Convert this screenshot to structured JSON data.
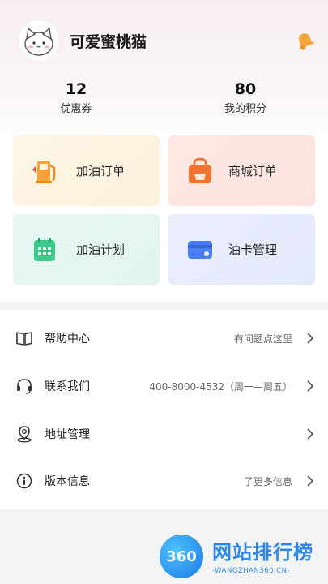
{
  "profile": {
    "username": "可爱蜜桃猫"
  },
  "stats": [
    {
      "value": "12",
      "label": "优惠券"
    },
    {
      "value": "80",
      "label": "我的积分"
    }
  ],
  "cards": [
    {
      "label": "加油订单",
      "icon": "fuel-pump-icon"
    },
    {
      "label": "商城订单",
      "icon": "shopping-bag-icon"
    },
    {
      "label": "加油计划",
      "icon": "calendar-icon"
    },
    {
      "label": "油卡管理",
      "icon": "card-icon"
    }
  ],
  "menu": [
    {
      "label": "帮助中心",
      "value": "有问题点这里",
      "icon": "book-icon"
    },
    {
      "label": "联系我们",
      "value": "400-8000-4532（周一—周五）",
      "icon": "headset-icon"
    },
    {
      "label": "地址管理",
      "value": "",
      "icon": "location-icon"
    },
    {
      "label": "版本信息",
      "value": "了更多信息",
      "icon": "info-icon"
    }
  ],
  "watermark": {
    "logo": "360",
    "title": "网站排行榜",
    "subtitle": "-WANGZHAN360.CN-"
  },
  "colors": {
    "accent_blue": "#2b87e8",
    "fuel_orange": "#f5a43b",
    "bag_orange": "#f4722f",
    "calendar_green": "#3cc98a",
    "card_blue": "#4a7ff0"
  }
}
